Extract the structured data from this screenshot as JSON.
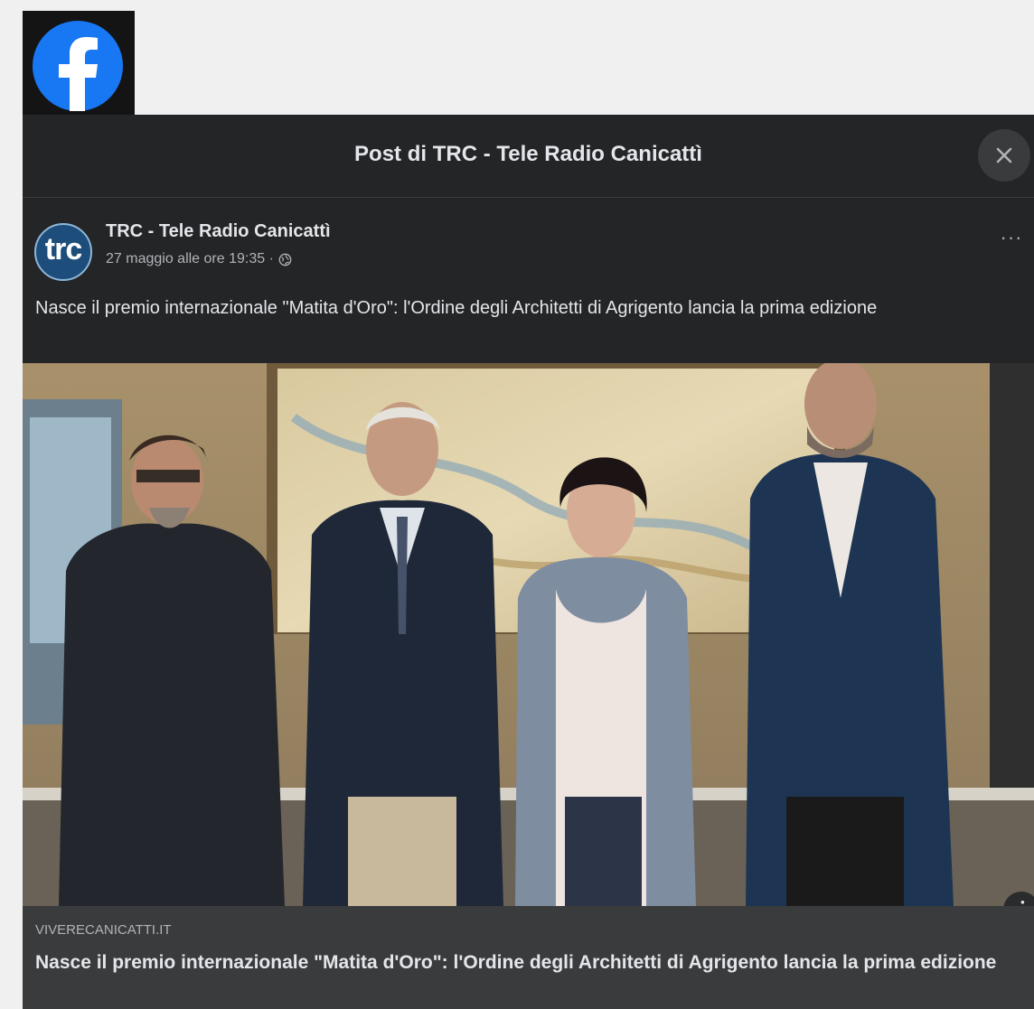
{
  "logo": {
    "icon": "facebook-logo-icon",
    "color": "#1877f2"
  },
  "modal": {
    "title": "Post di TRC - Tele Radio Canicattì",
    "close_icon": "close-icon"
  },
  "post": {
    "avatar_text": "trc",
    "author": "TRC - Tele Radio Canicattì",
    "timestamp": "27 maggio alle ore 19:35 ·",
    "audience_icon": "globe-icon",
    "more_label": "···",
    "text": "Nasce il premio internazionale \"Matita d'Oro\": l'Ordine degli Architetti di Agrigento lancia la prima edizione"
  },
  "photo": {
    "info_label": "i"
  },
  "link_preview": {
    "domain": "VIVERECANICATTI.IT",
    "title": "Nasce il premio internazionale \"Matita d'Oro\": l'Ordine degli Architetti di Agrigento lancia la prima edizione"
  }
}
